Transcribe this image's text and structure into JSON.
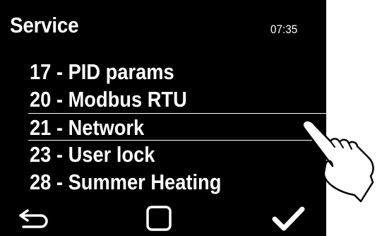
{
  "screen": {
    "title": "Service",
    "clock": "07:35"
  },
  "menu": {
    "selected_index": 2,
    "items": [
      {
        "label": "17 - PID params"
      },
      {
        "label": "20 - Modbus RTU"
      },
      {
        "label": "21 - Network"
      },
      {
        "label": "23 - User lock"
      },
      {
        "label": "28 - Summer Heating"
      }
    ]
  },
  "footer": {
    "back_icon": "back-arrow-icon",
    "home_icon": "square-icon",
    "confirm_icon": "checkmark-icon"
  },
  "overlay": {
    "icon": "pointing-hand-icon"
  },
  "colors": {
    "background": "#000000",
    "text": "#ffffff"
  }
}
